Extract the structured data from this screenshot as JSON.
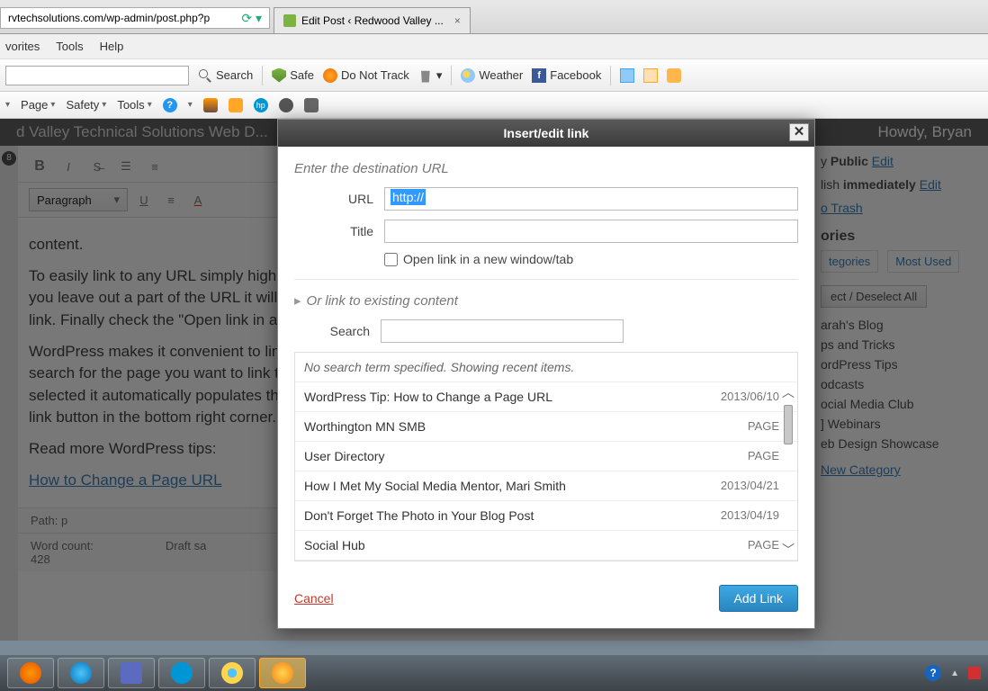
{
  "browser": {
    "url": "rvtechsolutions.com/wp-admin/post.php?p",
    "tab_title": "Edit Post ‹ Redwood Valley ...",
    "menu": {
      "favorites": "vorites",
      "tools": "Tools",
      "help": "Help"
    },
    "toolbar": {
      "search": "Search",
      "safe": "Safe",
      "dnt": "Do Not Track",
      "weather": "Weather",
      "facebook": "Facebook"
    },
    "toolbar2": {
      "page": "Page",
      "safety": "Safety",
      "tools": "Tools"
    }
  },
  "wp": {
    "site_title": "d Valley Technical Solutions Web D...",
    "greeting": "Howdy, Bryan",
    "badge_count": "8",
    "format_select": "Paragraph",
    "body": {
      "p1": "content.",
      "p2": "To easily link to any URL simply highlight the text you want to link and when I say entire web address I mean it. If you leave out a part of the URL it will be broken. Next fill in the title, which will display text when hovering over the link. Finally check the \"Open link in a new window/tab\" checkbox which opens a link that is not on your website.",
      "p3": "WordPress makes it convenient to link to existing pages on your website. Click \"Link to existing content\" then search for the page you want to link to. Once you find the page you are looking for select it. Now that the page is selected it automatically populates the URL and Title fields. The last step toward adding the link is to click the add link button in the bottom right corner. I'm confident this is the first of many links on your pages.",
      "p4": "Read more WordPress tips:",
      "link": "How to Change a Page URL"
    },
    "status_path": "Path: p",
    "word_count_label": "Word count:",
    "word_count": "428",
    "draft_saved": "Draft sa",
    "sidebar": {
      "visibility_label": "y",
      "visibility_value": "Public",
      "edit": "Edit",
      "publish_label": "lish",
      "publish_value": "immediately",
      "edit2": "Edit",
      "trash": "o Trash",
      "categories_heading": "ories",
      "tab_all": "tegories",
      "tab_most": "Most Used",
      "select_all": "ect / Deselect All",
      "cats": [
        "arah's Blog",
        "ps and Tricks",
        "ordPress Tips",
        "odcasts",
        "ocial Media Club",
        "] Webinars",
        "eb Design Showcase"
      ],
      "add_new": "New Category"
    }
  },
  "dialog": {
    "title": "Insert/edit link",
    "hint": "Enter the destination URL",
    "url_label": "URL",
    "url_value": "http://",
    "title_label": "Title",
    "open_new": "Open link in a new window/tab",
    "existing_hint": "Or link to existing content",
    "search_label": "Search",
    "results_hint": "No search term specified. Showing recent items.",
    "results": [
      {
        "title": "WordPress Tip: How to Change a Page URL",
        "meta": "2013/06/10"
      },
      {
        "title": "Worthington MN SMB",
        "meta": "PAGE"
      },
      {
        "title": "User Directory",
        "meta": "PAGE"
      },
      {
        "title": "How I Met My Social Media Mentor, Mari Smith",
        "meta": "2013/04/21"
      },
      {
        "title": "Don't Forget The Photo in Your Blog Post",
        "meta": "2013/04/19"
      },
      {
        "title": "Social Hub",
        "meta": "PAGE"
      }
    ],
    "cancel": "Cancel",
    "add": "Add Link"
  }
}
